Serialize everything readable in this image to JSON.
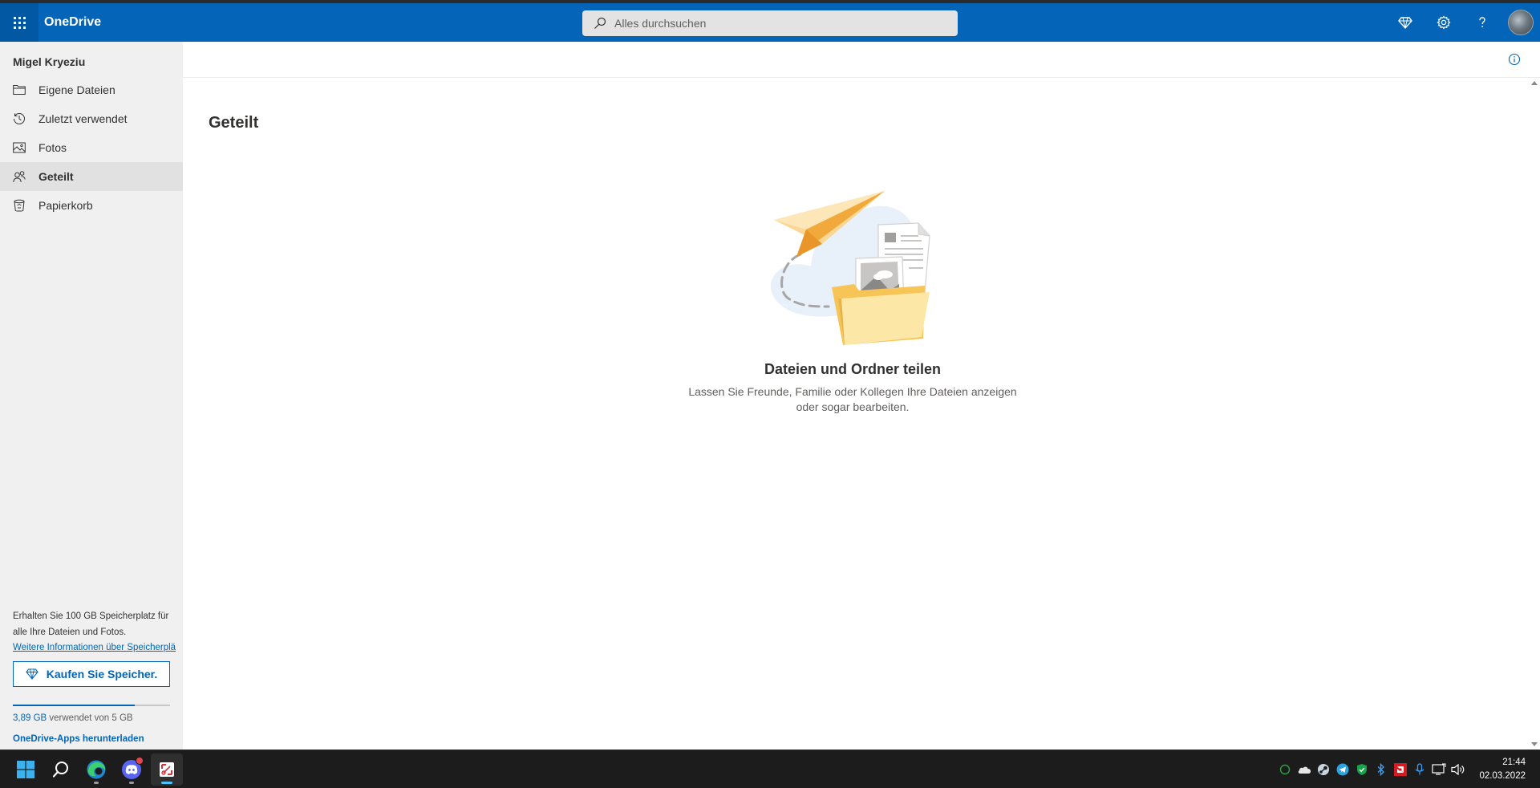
{
  "header": {
    "app_name": "OneDrive",
    "search_placeholder": "Alles durchsuchen"
  },
  "sidebar": {
    "user_name": "Migel Kryeziu",
    "items": [
      {
        "label": "Eigene Dateien",
        "icon": "folder-icon",
        "active": false
      },
      {
        "label": "Zuletzt verwendet",
        "icon": "recent-icon",
        "active": false
      },
      {
        "label": "Fotos",
        "icon": "photo-icon",
        "active": false
      },
      {
        "label": "Geteilt",
        "icon": "shared-icon",
        "active": true
      },
      {
        "label": "Papierkorb",
        "icon": "recycle-bin-icon",
        "active": false
      }
    ],
    "promo_text": "Erhalten Sie 100 GB Speicherplatz für alle Ihre Dateien und Fotos.",
    "promo_link": "Weitere Informationen über Speicherplä",
    "buy_label": "Kaufen Sie Speicher.",
    "quota_used": "3,89 GB",
    "quota_rest": " verwendet von 5 GB",
    "quota_fraction": 0.778,
    "apps_link": "OneDrive-Apps herunterladen"
  },
  "main": {
    "page_title": "Geteilt",
    "empty_title": "Dateien und Ordner teilen",
    "empty_description": "Lassen Sie Freunde, Familie oder Kollegen Ihre Dateien anzeigen oder sogar bearbeiten."
  },
  "taskbar": {
    "time": "21:44",
    "date": "02.03.2022"
  },
  "colors": {
    "brand": "#0364b8",
    "nav_bg": "#f0f0f0",
    "taskbar_bg": "#1c1c1c"
  }
}
